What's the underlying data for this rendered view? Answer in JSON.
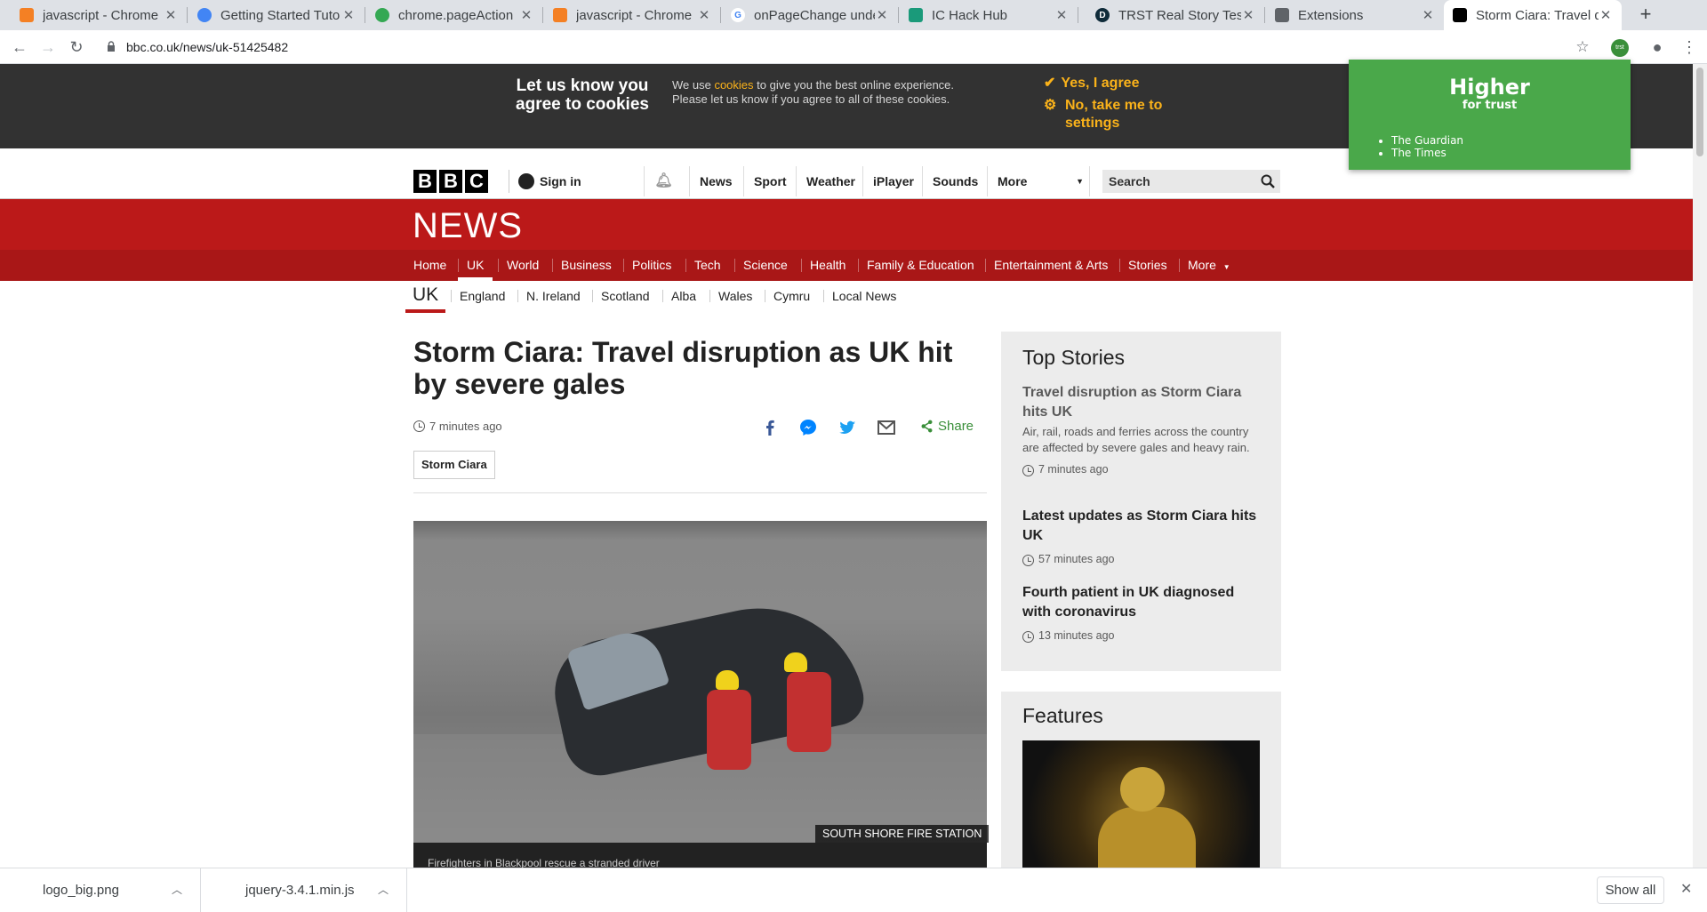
{
  "browser": {
    "tabs": [
      {
        "title": "javascript - Chrome",
        "active": false,
        "icon": "stackoverflow-icon"
      },
      {
        "title": "Getting Started Tuto",
        "active": false,
        "icon": "chrome-icon"
      },
      {
        "title": "chrome.pageAction",
        "active": false,
        "icon": "chrome-icon"
      },
      {
        "title": "javascript - Chrome",
        "active": false,
        "icon": "stackoverflow-icon"
      },
      {
        "title": "onPageChange unde",
        "active": false,
        "icon": "google-icon"
      },
      {
        "title": "IC Hack Hub",
        "active": false,
        "icon": "ichack-icon"
      },
      {
        "title": "TRST Real Story Test",
        "active": false,
        "icon": "trst-icon"
      },
      {
        "title": "Extensions",
        "active": false,
        "icon": "puzzle-icon"
      },
      {
        "title": "Storm Ciara: Travel d",
        "active": true,
        "icon": "bbc-icon"
      }
    ],
    "url": "bbc.co.uk/news/uk-51425482",
    "extension_badge": "trst"
  },
  "cookie_banner": {
    "heading": "Let us know you agree to cookies",
    "text_before": "We use ",
    "text_link": "cookies",
    "text_after": " to give you the best online experience. Please let us know if you agree to all of these cookies.",
    "agree": "Yes, I agree",
    "settings": "No, take me to settings"
  },
  "trst_popup": {
    "title": "Higher",
    "subtitle": "for trust",
    "sources": [
      "The Guardian",
      "The Times"
    ]
  },
  "masthead": {
    "logo": [
      "B",
      "B",
      "C"
    ],
    "sign_in": "Sign in",
    "nav": [
      "News",
      "Sport",
      "Weather",
      "iPlayer",
      "Sounds",
      "More"
    ],
    "search_placeholder": "Search"
  },
  "news": {
    "logo": "NEWS",
    "sections": [
      "Home",
      "UK",
      "World",
      "Business",
      "Politics",
      "Tech",
      "Science",
      "Health",
      "Family & Education",
      "Entertainment & Arts",
      "Stories",
      "More"
    ],
    "active_section": "UK",
    "subsections": [
      "UK",
      "England",
      "N. Ireland",
      "Scotland",
      "Alba",
      "Wales",
      "Cymru",
      "Local News"
    ]
  },
  "article": {
    "headline": "Storm Ciara: Travel disruption as UK hit by severe gales",
    "time": "7 minutes ago",
    "tag": "Storm Ciara",
    "share": "Share",
    "image_credit": "SOUTH SHORE FIRE STATION",
    "caption": "Firefighters in Blackpool rescue a stranded driver"
  },
  "top_stories": {
    "title": "Top Stories",
    "items": [
      {
        "headline": "Travel disruption as Storm Ciara hits UK",
        "summary": "Air, rail, roads and ferries across the country are affected by severe gales and heavy rain.",
        "time": "7 minutes ago"
      },
      {
        "headline": "Latest updates as Storm Ciara hits UK",
        "time": "57 minutes ago"
      },
      {
        "headline": "Fourth patient in UK diagnosed with coronavirus",
        "time": "13 minutes ago"
      }
    ]
  },
  "features": {
    "title": "Features"
  },
  "downloads": {
    "items": [
      "logo_big.png",
      "jquery-3.4.1.min.js"
    ],
    "show_all": "Show all"
  }
}
